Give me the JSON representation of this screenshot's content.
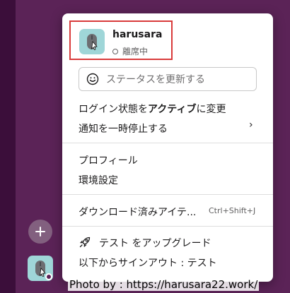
{
  "user": {
    "name": "harusara",
    "status": "離席中"
  },
  "status_input": {
    "placeholder": "ステータスを更新する"
  },
  "menu": {
    "login_state": {
      "prefix": "ログイン状態を",
      "bold": "アクティブ",
      "suffix": "に変更"
    },
    "pause_notifications": "通知を一時停止する",
    "profile": "プロフィール",
    "preferences": "環境設定",
    "downloads": "ダウンロード済みアイテ...",
    "downloads_shortcut": "Ctrl+Shift+J",
    "upgrade": "テスト をアップグレード",
    "sign_out": "以下からサインアウト : テスト"
  },
  "watermark": "Photo by : https://harusara22.work/",
  "colors": {
    "sidebar": "#5b2357",
    "highlight_border": "#d93a3a",
    "avatar_bg": "#9fd6d8"
  },
  "icons": [
    "plus-icon",
    "smile-icon",
    "chevron-right-icon",
    "rocket-icon",
    "mouse-avatar-icon"
  ]
}
